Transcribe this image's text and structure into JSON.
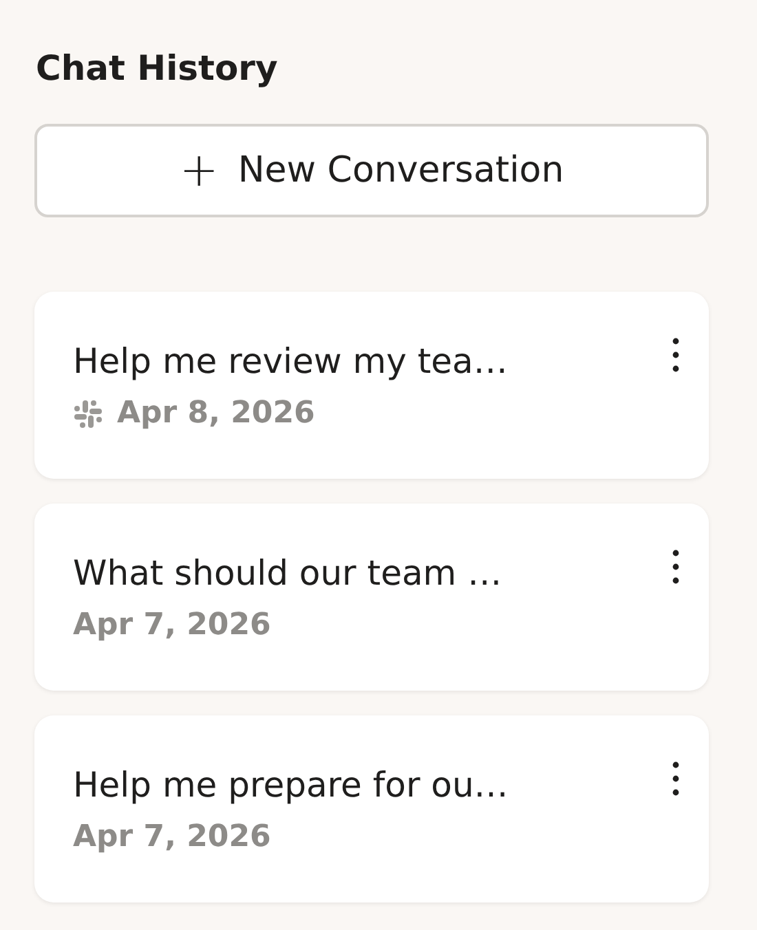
{
  "title": "Chat History",
  "new_button": {
    "icon": "+",
    "label": "New Conversation"
  },
  "conversations": [
    {
      "title": "Help me review my tea…",
      "date": "Apr 8, 2026",
      "source_icon": true
    },
    {
      "title": "What should our team …",
      "date": "Apr 7, 2026",
      "source_icon": false
    },
    {
      "title": "Help me prepare for ou…",
      "date": "Apr 7, 2026",
      "source_icon": false
    }
  ]
}
